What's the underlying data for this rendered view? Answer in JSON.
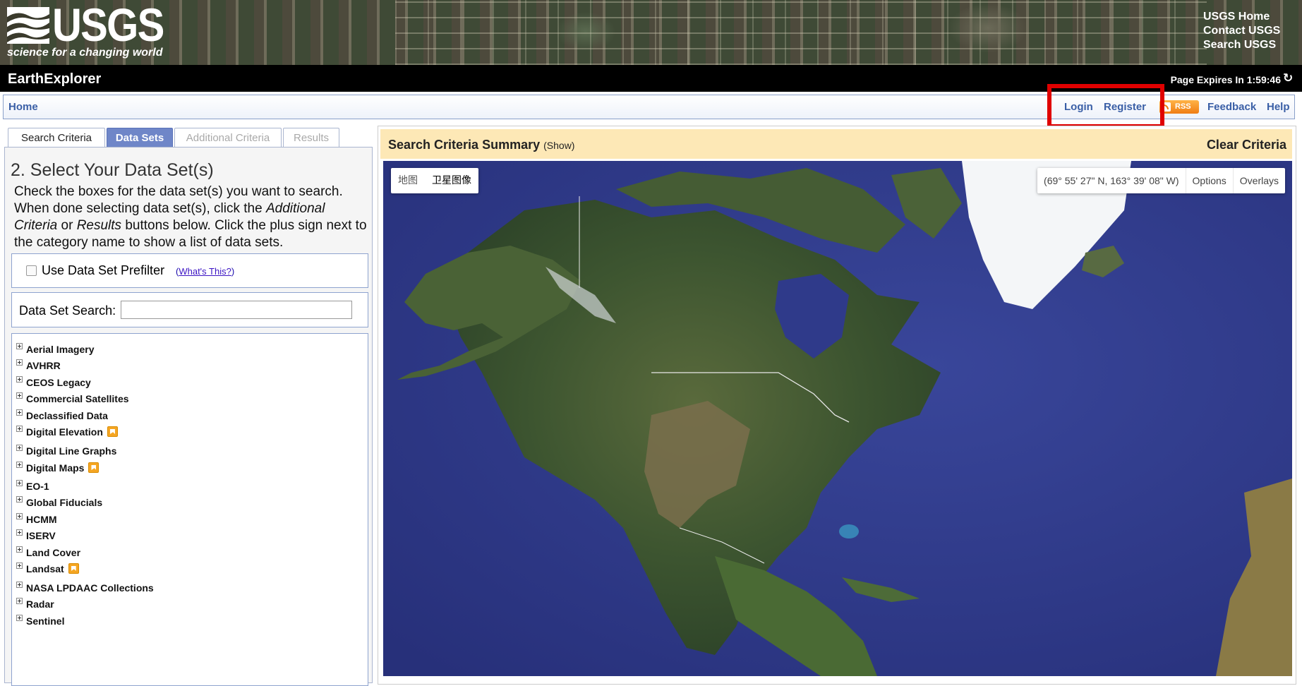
{
  "header": {
    "logo_text": "USGS",
    "tagline": "science for a changing world",
    "links": [
      "USGS Home",
      "Contact USGS",
      "Search USGS"
    ]
  },
  "titlebar": {
    "app_name": "EarthExplorer",
    "expires_label": "Page Expires In",
    "expires_time": "1:59:46"
  },
  "nav": {
    "home": "Home",
    "login": "Login",
    "register": "Register",
    "rss": "RSS",
    "feedback": "Feedback",
    "help": "Help"
  },
  "tabs": [
    {
      "label": "Search Criteria",
      "state": "normal"
    },
    {
      "label": "Data Sets",
      "state": "active"
    },
    {
      "label": "Additional Criteria",
      "state": "disabled"
    },
    {
      "label": "Results",
      "state": "disabled"
    }
  ],
  "left": {
    "heading": "2. Select Your Data Set(s)",
    "intro_1": "Check the boxes for the data set(s) you want to search. When done selecting data set(s), click the ",
    "intro_em1": "Additional Criteria",
    "intro_2": " or ",
    "intro_em2": "Results",
    "intro_3": " buttons below. Click the plus sign next to the category name to show a list of data sets.",
    "prefilter_label": "Use Data Set Prefilter",
    "whats_this": "What's This?",
    "search_label": "Data Set Search:",
    "search_value": "",
    "categories": [
      {
        "label": "Aerial Imagery",
        "badge": false
      },
      {
        "label": "AVHRR",
        "badge": false
      },
      {
        "label": "CEOS Legacy",
        "badge": false
      },
      {
        "label": "Commercial Satellites",
        "badge": false
      },
      {
        "label": "Declassified Data",
        "badge": false
      },
      {
        "label": "Digital Elevation",
        "badge": true
      },
      {
        "label": "Digital Line Graphs",
        "badge": false
      },
      {
        "label": "Digital Maps",
        "badge": true
      },
      {
        "label": "EO-1",
        "badge": false
      },
      {
        "label": "Global Fiducials",
        "badge": false
      },
      {
        "label": "HCMM",
        "badge": false
      },
      {
        "label": "ISERV",
        "badge": false
      },
      {
        "label": "Land Cover",
        "badge": false
      },
      {
        "label": "Landsat",
        "badge": true
      },
      {
        "label": "NASA LPDAAC Collections",
        "badge": false
      },
      {
        "label": "Radar",
        "badge": false
      },
      {
        "label": "Sentinel",
        "badge": false
      }
    ]
  },
  "summary": {
    "title": "Search Criteria Summary",
    "show": "(Show)",
    "clear": "Clear Criteria"
  },
  "map": {
    "type_map": "地图",
    "type_satellite": "卫星图像",
    "coords": "(69° 55' 27\" N, 163° 39' 08\" W)",
    "options": "Options",
    "overlays": "Overlays"
  },
  "colors": {
    "highlight": "#e00000",
    "active_tab": "#6f86c8",
    "summary_bg": "#fde8b6",
    "ocean": "#2f3a8a",
    "land": "#3b5230"
  }
}
